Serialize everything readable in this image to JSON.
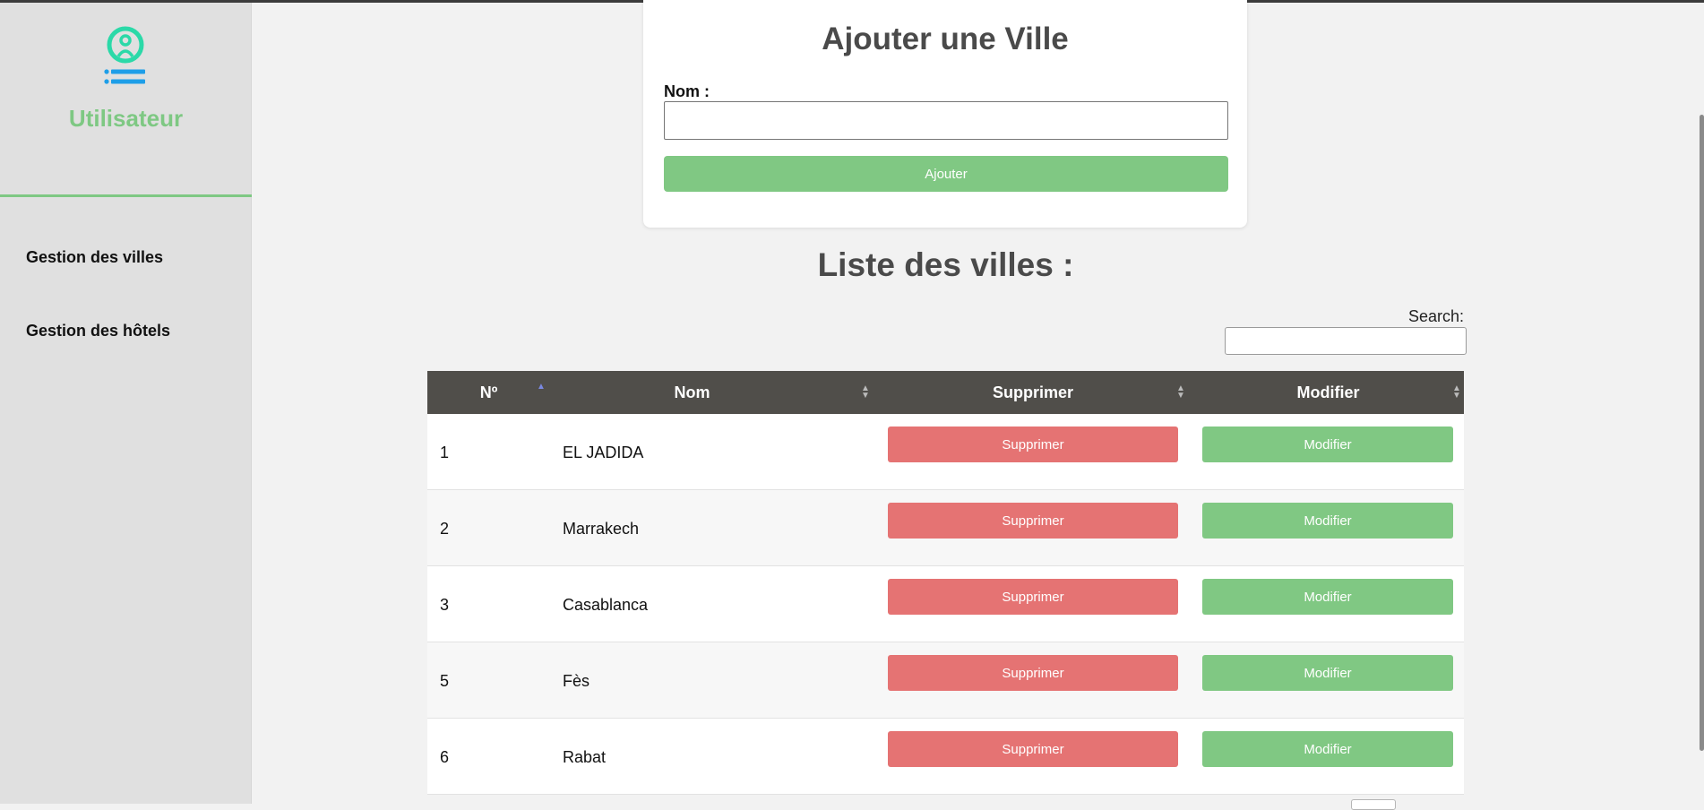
{
  "sidebar": {
    "user_label": "Utilisateur",
    "user_icon": "user-list-icon",
    "nav": [
      {
        "label": "Gestion des villes"
      },
      {
        "label": "Gestion des hôtels"
      }
    ]
  },
  "form": {
    "title": "Ajouter une Ville",
    "name_label": "Nom :",
    "name_value": "",
    "submit_label": "Ajouter"
  },
  "list": {
    "title": "Liste des villes :",
    "search_label": "Search:",
    "search_value": "",
    "columns": [
      "Nº",
      "Nom",
      "Supprimer",
      "Modifier"
    ],
    "sorted_column": "Nº",
    "rows": [
      {
        "num": "1",
        "name": "EL JADIDA",
        "delete_label": "Supprimer",
        "edit_label": "Modifier"
      },
      {
        "num": "2",
        "name": "Marrakech",
        "delete_label": "Supprimer",
        "edit_label": "Modifier"
      },
      {
        "num": "3",
        "name": "Casablanca",
        "delete_label": "Supprimer",
        "edit_label": "Modifier"
      },
      {
        "num": "5",
        "name": "Fès",
        "delete_label": "Supprimer",
        "edit_label": "Modifier"
      },
      {
        "num": "6",
        "name": "Rabat",
        "delete_label": "Supprimer",
        "edit_label": "Modifier"
      }
    ]
  },
  "colors": {
    "accent_green": "#80c883",
    "danger_red": "#e57373",
    "header_dark": "#504e4a",
    "icon_teal": "#2bd9a8",
    "icon_blue": "#1e9ee8"
  }
}
